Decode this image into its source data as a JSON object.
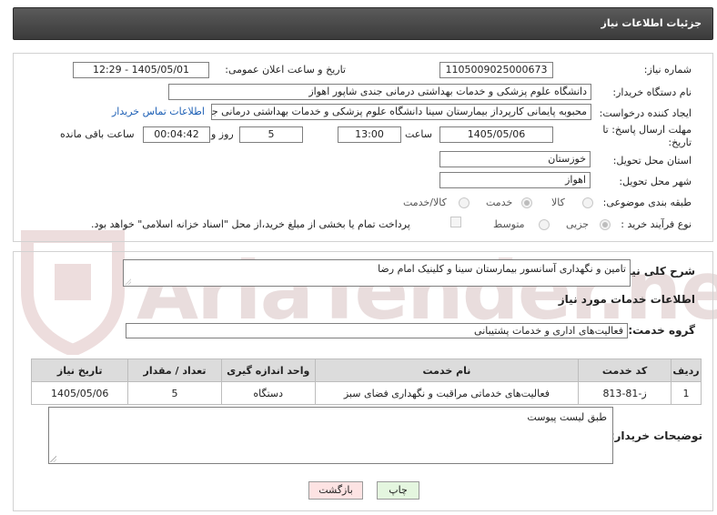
{
  "header": {
    "title": "جزئیات اطلاعات نیاز"
  },
  "watermark": {
    "text": "AriaTender.net"
  },
  "fields": {
    "need_number_label": "شماره نیاز:",
    "need_number": "1105009025000673",
    "announce_label": "تاریخ و ساعت اعلان عمومی:",
    "announce_value": "1405/05/01 - 12:29",
    "buyer_org_label": "نام دستگاه خریدار:",
    "buyer_org": "دانشگاه علوم پزشکی و خدمات بهداشتی درمانی جندی شاپور اهواز",
    "creator_label": "ایجاد کننده درخواست:",
    "creator": "محبوبه پایمانی کارپرداز بیمارستان سینا دانشگاه علوم پزشکی و خدمات بهداشتی درمانی جندی شاپور اهواز",
    "contact_link": "اطلاعات تماس خریدار",
    "deadline_label_1": "مهلت ارسال پاسخ: تا",
    "deadline_label_2": "تاریخ:",
    "deadline_date": "1405/05/06",
    "time_label": "ساعت",
    "deadline_time": "13:00",
    "days_value": "5",
    "days_label": "روز و",
    "remaining_value": "00:04:42",
    "remaining_label": "ساعت باقی مانده",
    "province_label": "استان محل تحویل:",
    "province": "خوزستان",
    "city_label": "شهر محل تحویل:",
    "city": "اهواز",
    "category_label": "طبقه بندی موضوعی:",
    "category_options": [
      "کالا",
      "خدمت",
      "کالا/خدمت"
    ],
    "category_selected": "خدمت",
    "purchase_type_label": "نوع فرآیند خرید :",
    "purchase_options": [
      "جزیی",
      "متوسط"
    ],
    "purchase_selected": "جزیی",
    "payment_note": "پرداخت تمام یا بخشی از مبلغ خرید،از محل \"اسناد خزانه اسلامی\" خواهد بود."
  },
  "summary": {
    "label": "شرح کلی نیاز:",
    "value": "تامین و نگهداری آسانسور بیمارستان سینا  و کلینیک امام رضا"
  },
  "services": {
    "section_title": "اطلاعات خدمات مورد نیاز",
    "group_label": "گروه خدمت:",
    "group_value": "فعالیت‌های اداری و خدمات پشتیبانی",
    "table": {
      "headers": [
        "ردیف",
        "کد خدمت",
        "نام خدمت",
        "واحد اندازه گیری",
        "تعداد / مقدار",
        "تاریخ نیاز"
      ],
      "rows": [
        [
          "1",
          "ز-81-813",
          "فعالیت‌های خدماتی مراقبت و نگهداری فضای سبز",
          "دستگاه",
          "5",
          "1405/05/06"
        ]
      ]
    }
  },
  "buyer_notes": {
    "label": "توضیحات خریدار:",
    "value": "طبق لیست پیوست"
  },
  "buttons": {
    "print": "چاپ",
    "back": "بازگشت"
  },
  "colors": {
    "header_bg": "#444444",
    "link": "#1c5fb5",
    "back_button_bg": "#fde3e3",
    "print_button_bg": "#e4f6df"
  }
}
